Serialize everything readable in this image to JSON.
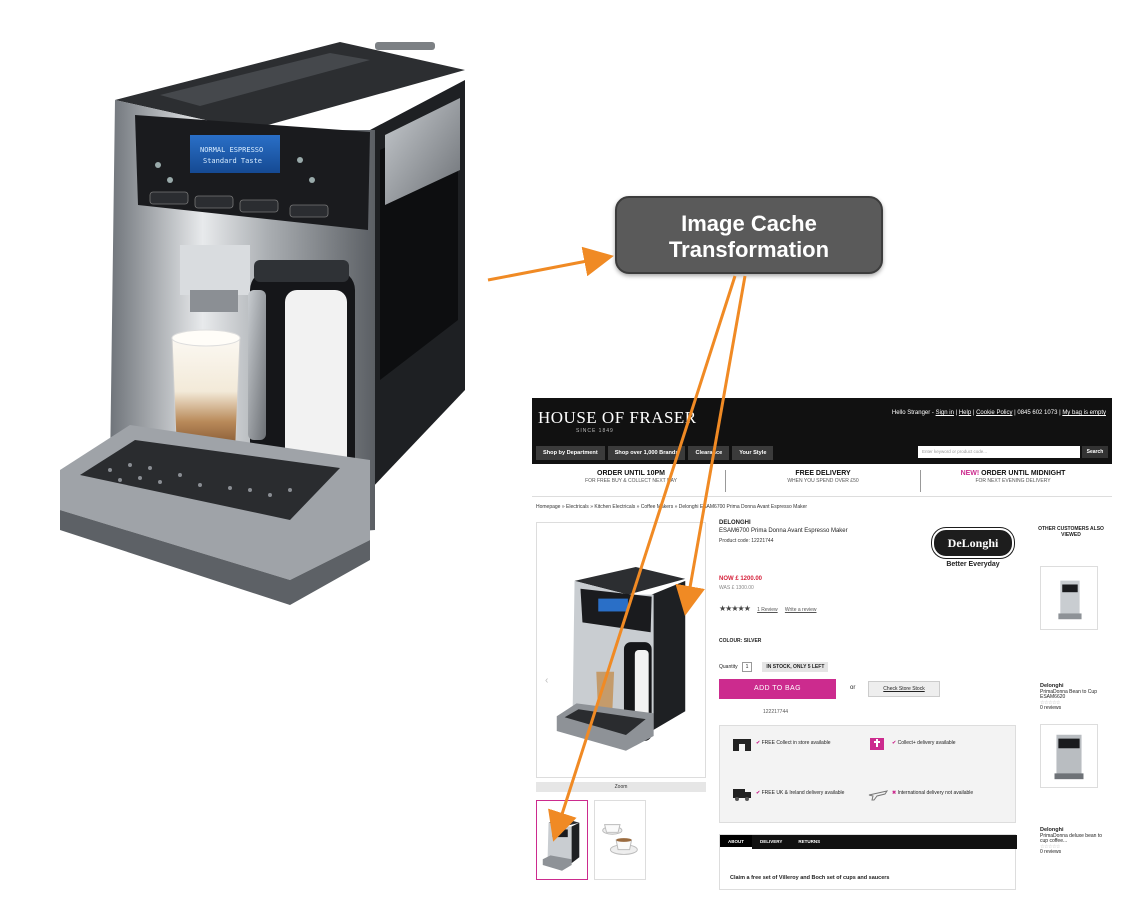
{
  "callout": {
    "line1": "Image Cache",
    "line2": "Transformation"
  },
  "site": {
    "logo": "HOUSE OF FRASER",
    "logo_sub": "SINCE 1849",
    "top_links": {
      "hello": "Hello Stranger - ",
      "sign_in": "Sign in",
      "help": "Help",
      "cookie": "Cookie Policy",
      "phone": "0845 602 1073",
      "bag": "My bag is empty"
    },
    "nav": [
      "Shop by Department",
      "Shop over 1,000 Brands",
      "Clearance",
      "Your Style"
    ],
    "search_placeholder": "Enter keyword or product code...",
    "search_button": "Search",
    "promos": [
      {
        "title": "ORDER UNTIL 10PM",
        "sub": "FOR FREE BUY & COLLECT NEXT DAY"
      },
      {
        "title": "FREE DELIVERY",
        "sub": "WHEN YOU SPEND OVER £50"
      },
      {
        "title_accent": "NEW!",
        "title": " ORDER UNTIL MIDNIGHT",
        "sub": "FOR NEXT EVENING DELIVERY"
      }
    ],
    "breadcrumb": "Homepage » Electricals » Kitchen Electricals » Coffee Makers » Delonghi ESAM6700 Prima Donna Avant Espresso Maker",
    "product": {
      "brand": "DELONGHI",
      "name": "ESAM6700 Prima Donna Avant Espresso Maker",
      "code": "Product code: 12221744",
      "now": "NOW £ 1200.00",
      "was": "WAS £ 1300.00",
      "stars": "★★★★★",
      "reviews": "1 Review",
      "write_review": "Write a review",
      "colour": "COLOUR: SILVER",
      "qty_label": "Quantity",
      "qty_value": "1",
      "stock": "IN STOCK, ONLY 5 LEFT",
      "add_to_bag": "ADD TO BAG",
      "or": "or",
      "store_stock": "Check Store Stock",
      "number": "122217744",
      "zoom": "Zoom",
      "brand_badge": "DeLonghi",
      "brand_tagline": "Better Everyday"
    },
    "delivery": [
      {
        "mark": "✔",
        "text": "FREE Collect in store available"
      },
      {
        "mark": "✔",
        "text": "Collect+ delivery available"
      },
      {
        "mark": "✔",
        "text": "FREE UK & Ireland delivery available"
      },
      {
        "mark": "✖",
        "text": "International delivery not available"
      }
    ],
    "tabs": [
      "ABOUT",
      "DELIVERY",
      "RETURNS"
    ],
    "claim": "Claim a free set of Villeroy and Boch set of cups and saucers",
    "sidebar": {
      "heading": "OTHER CUSTOMERS ALSO VIEWED",
      "items": [
        {
          "brand": "Delonghi",
          "name": "PrimaDonna Bean to Cup ESAM6620",
          "reviews": "0 reviews"
        },
        {
          "brand": "Delonghi",
          "name": "PrimaDonna deluxe bean to cup coffee...",
          "reviews": "0 reviews"
        }
      ]
    }
  },
  "colors": {
    "accent": "#cc2b8e",
    "arrow": "#f08a24",
    "callout": "#5a5a5a"
  }
}
